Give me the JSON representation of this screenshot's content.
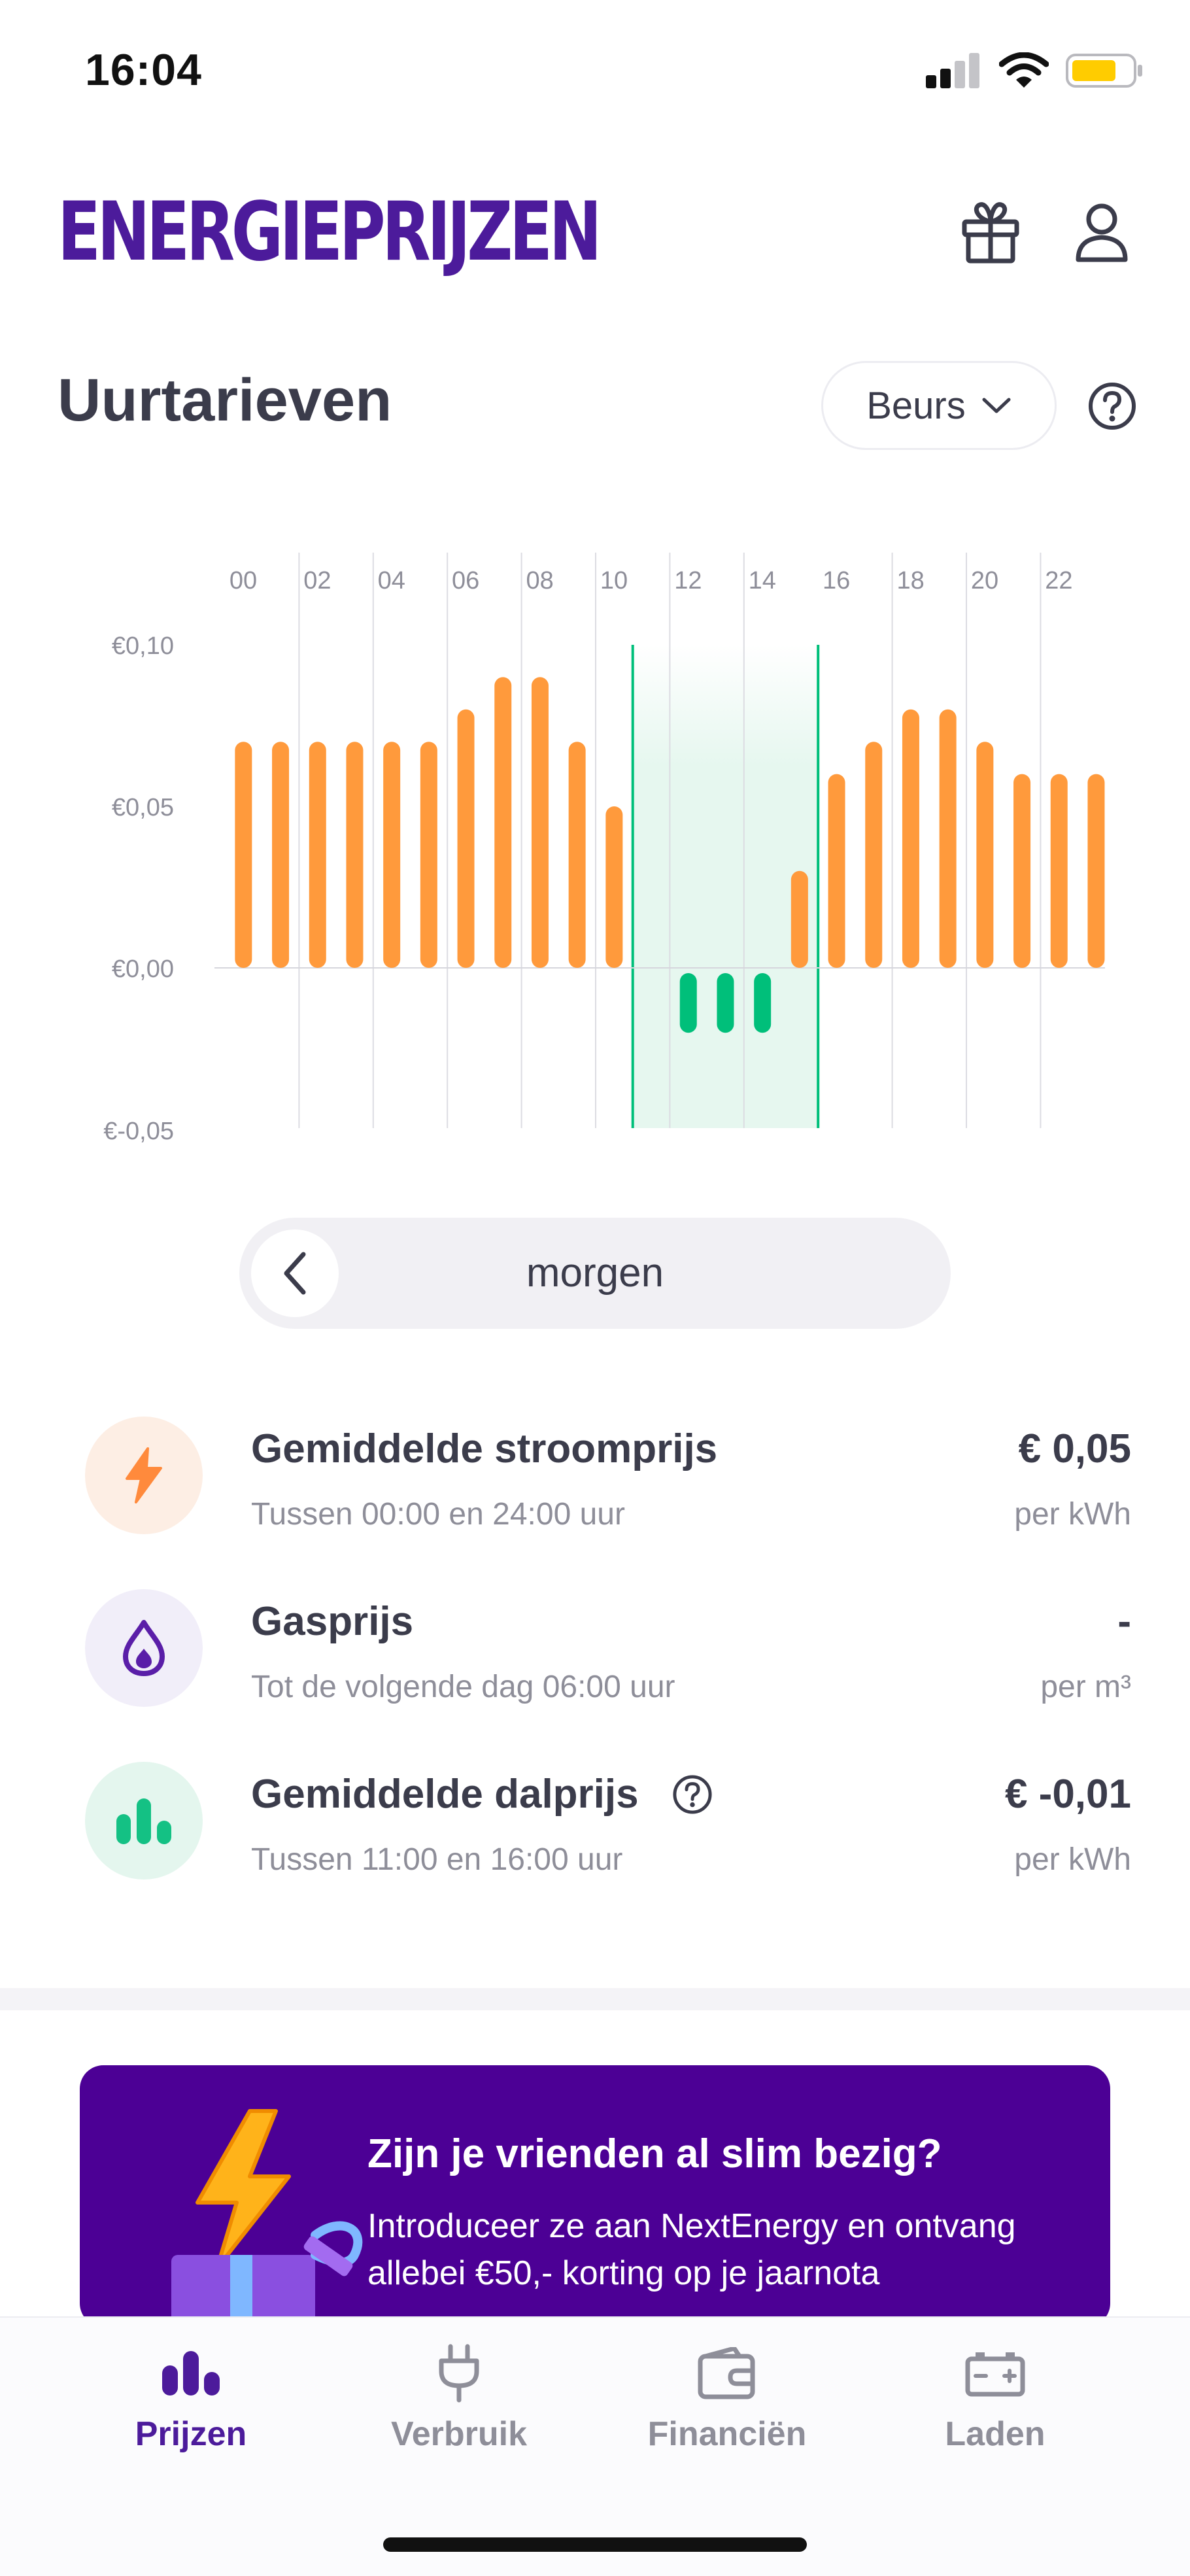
{
  "status_bar": {
    "time": "16:04"
  },
  "header": {
    "brand": "ENERGIEPRIJZEN",
    "icons": [
      "gift-icon",
      "user-icon"
    ]
  },
  "prices_section": {
    "title": "Uurtarieven",
    "mode_select": "Beurs",
    "help_icon": "question-circle-icon"
  },
  "colors": {
    "brand": "#4c1b9b",
    "bar_positive": "#ff9a3c",
    "bar_offpeak": "#00bf7a",
    "offpeak_band": "#e6f7ef",
    "promo_bg": "#4c0095"
  },
  "chart_data": {
    "type": "bar",
    "x_tick_labels": [
      "00",
      "02",
      "04",
      "06",
      "08",
      "10",
      "12",
      "14",
      "16",
      "18",
      "20",
      "22"
    ],
    "hours": [
      0,
      1,
      2,
      3,
      4,
      5,
      6,
      7,
      8,
      9,
      10,
      11,
      12,
      13,
      14,
      15,
      16,
      17,
      18,
      19,
      20,
      21,
      22,
      23
    ],
    "values": [
      0.07,
      0.07,
      0.07,
      0.07,
      0.07,
      0.07,
      0.08,
      0.09,
      0.09,
      0.07,
      0.05,
      0.0,
      -0.02,
      -0.02,
      -0.02,
      0.03,
      0.06,
      0.07,
      0.08,
      0.08,
      0.07,
      0.06,
      0.06,
      0.06
    ],
    "y_tick_labels": [
      "€0,10",
      "€0,05",
      "€0,00",
      "€-0,05"
    ],
    "y_ticks": [
      0.1,
      0.05,
      0.0,
      -0.05
    ],
    "ylim": [
      -0.05,
      0.1
    ],
    "highlight_range_hours": [
      11,
      16
    ],
    "grid": true
  },
  "day_nav": {
    "label": "morgen"
  },
  "price_rows": [
    {
      "icon": "lightning-icon",
      "title": "Gemiddelde stroomprijs",
      "subtitle": "Tussen 00:00 en 24:00 uur",
      "value": "€ 0,05",
      "unit": "per kWh"
    },
    {
      "icon": "flame-icon",
      "title": "Gasprijs",
      "subtitle": "Tot de volgende dag 06:00 uur",
      "value": "-",
      "unit": "per m³"
    },
    {
      "icon": "bars-icon",
      "title": "Gemiddelde dalprijs",
      "subtitle": "Tussen 11:00 en 16:00 uur",
      "value": "€ -0,01",
      "unit": "per kWh"
    }
  ],
  "promo": {
    "headline": "Zijn je vrienden al slim bezig?",
    "body": "Introduceer ze aan NextEnergy en ontvang allebei €50,- korting op je jaarnota"
  },
  "tabs": [
    {
      "label": "Prijzen",
      "icon": "bar-chart-icon",
      "active": true
    },
    {
      "label": "Verbruik",
      "icon": "plug-icon",
      "active": false
    },
    {
      "label": "Financiën",
      "icon": "wallet-icon",
      "active": false
    },
    {
      "label": "Laden",
      "icon": "battery-icon",
      "active": false
    }
  ]
}
